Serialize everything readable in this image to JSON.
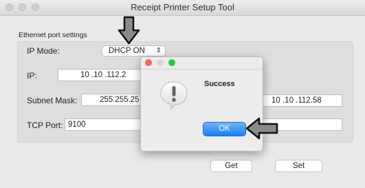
{
  "window": {
    "title": "Receipt Printer Setup Tool"
  },
  "settings": {
    "section_label": "Ethernet port settings",
    "ip_mode_label": "IP Mode:",
    "ip_mode_value": "DHCP ON",
    "ip_label": "IP:",
    "ip_value": "10 .10 .112.2",
    "subnet_label": "Subnet Mask:",
    "subnet_value": "255.255.25",
    "gateway_value": "10 .10 .112.58",
    "tcp_label": "TCP Port:",
    "tcp_value": "9100"
  },
  "buttons": {
    "get": "Get",
    "set": "Set"
  },
  "dialog": {
    "title": "Success",
    "ok": "OK",
    "close_color": "#fe5f57",
    "minimize_color": "#d6d6d6",
    "zoom_color": "#28c840",
    "ok_color": "#1a7ef2"
  },
  "icons": {
    "window_controls": [
      "close-icon",
      "minimize-icon",
      "zoom-icon"
    ],
    "alert": "exclamation-icon",
    "select": "chevron-updown-icon",
    "annotations": [
      "arrow-down-icon",
      "arrow-left-icon"
    ]
  }
}
